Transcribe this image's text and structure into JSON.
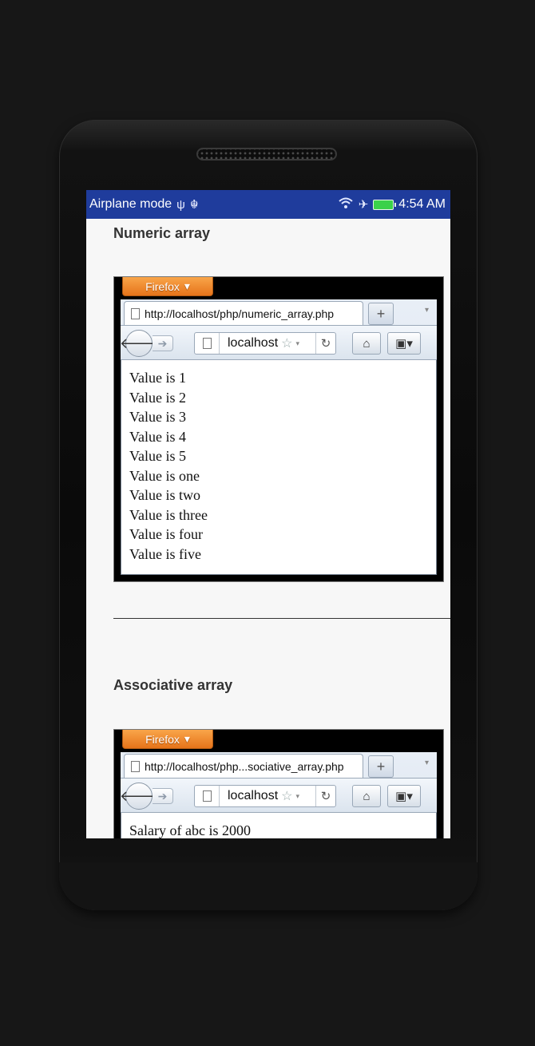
{
  "status_bar": {
    "airplane_mode": "Airplane mode",
    "usb_icon": "usb-icon",
    "android_icon": "android-debug-icon",
    "wifi_icon": "wifi-icon",
    "airplane_icon": "airplane-icon",
    "battery_icon": "battery-charging-icon",
    "time": "4:54 AM",
    "color": "#1f3c9c"
  },
  "section1": {
    "heading": "Numeric array",
    "firefox_label": "Firefox",
    "tab_url": "http://localhost/php/numeric_array.php",
    "address": "localhost",
    "lines": [
      "Value is 1",
      "Value is 2",
      "Value is 3",
      "Value is 4",
      "Value is 5",
      "Value is one",
      "Value is two",
      "Value is three",
      "Value is four",
      "Value is five"
    ]
  },
  "divider": "_________________________________________",
  "section2": {
    "heading": "Associative array",
    "firefox_label": "Firefox",
    "tab_url": "http://localhost/php...sociative_array.php",
    "address": "localhost",
    "lines": [
      "Salary of abc is 2000"
    ]
  }
}
